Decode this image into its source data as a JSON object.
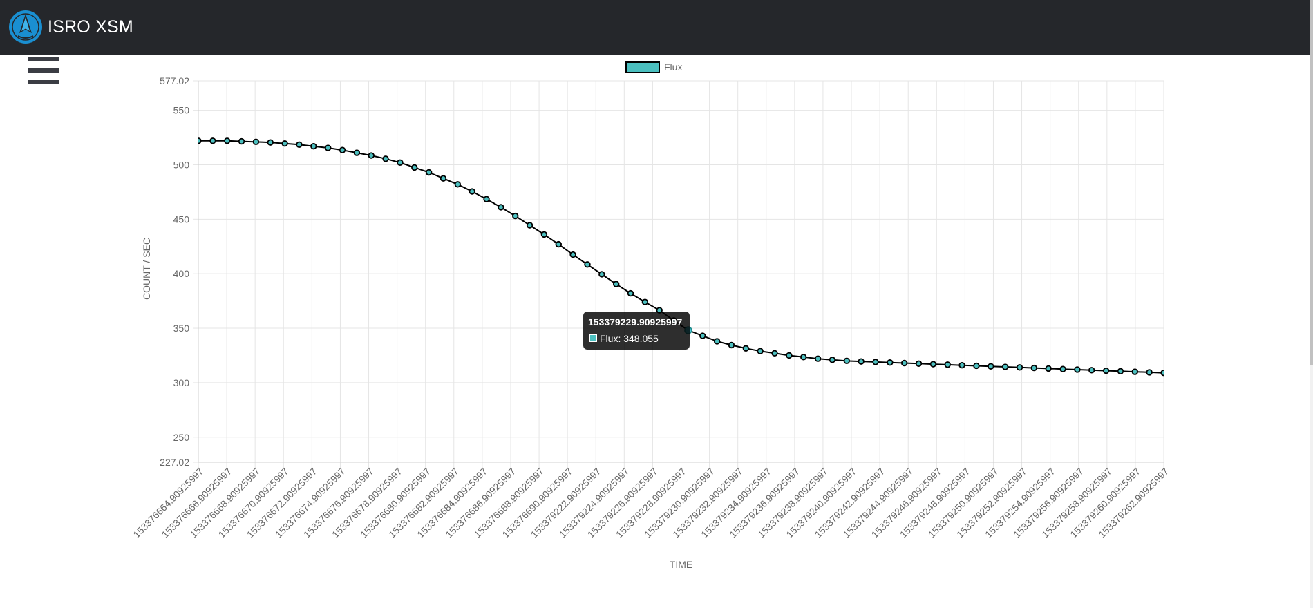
{
  "app": {
    "title": "ISRO XSM",
    "logo_icon": "isro-rocket-logo"
  },
  "menu": {
    "icon": "hamburger-menu-icon"
  },
  "colors": {
    "navbar": "#25272b",
    "series_fill": "#4bbfbf",
    "series_line": "#000000",
    "highlight": "#4bc8d8"
  },
  "chart_data": {
    "type": "line",
    "legend": [
      "Flux"
    ],
    "legend_position": "top",
    "xlabel": "TIME",
    "ylabel": "COUNT / SEC",
    "ylim": [
      227.02,
      577.02
    ],
    "yticks": [
      "577.02",
      "550",
      "500",
      "450",
      "400",
      "350",
      "300",
      "250",
      "227.02"
    ],
    "xticks": [
      "153376664.90925997",
      "153376666.90925997",
      "153376668.90925997",
      "153376670.90925997",
      "153376672.90925997",
      "153376674.90925997",
      "153376676.90925997",
      "153376678.90925997",
      "153376680.90925997",
      "153376682.90925997",
      "153376684.90925997",
      "153376686.90925997",
      "153376688.90925997",
      "153376690.90925997",
      "153379222.90925997",
      "153379224.90925997",
      "153379226.90925997",
      "153379228.90925997",
      "153379230.90925997",
      "153379232.90925997",
      "153379234.90925997",
      "153379236.90925997",
      "153379238.90925997",
      "153379240.90925997",
      "153379242.90925997",
      "153379244.90925997",
      "153379246.90925997",
      "153379248.90925997",
      "153379250.90925997",
      "153379252.90925997",
      "153379254.90925997",
      "153379256.90925997",
      "153379258.90925997",
      "153379260.90925997",
      "153379262.90925997"
    ],
    "grid": true,
    "series": [
      {
        "name": "Flux",
        "values": [
          522,
          522,
          522,
          521.5,
          521,
          520.5,
          519.5,
          518.5,
          517,
          515.5,
          513.5,
          511,
          508.5,
          505.5,
          502,
          497.5,
          493,
          487.5,
          482,
          475.5,
          468.5,
          461,
          453,
          444.5,
          436,
          427,
          417.5,
          408.5,
          399.5,
          390.5,
          382,
          374,
          366.5,
          357,
          348.055,
          343,
          338,
          334.5,
          331.5,
          329,
          327,
          325,
          323.5,
          322,
          321,
          320,
          319.5,
          319,
          318.5,
          318,
          317.5,
          317,
          316.5,
          316,
          315.5,
          315,
          314.5,
          314,
          313.5,
          313,
          312.5,
          312,
          311.5,
          311,
          310.5,
          310,
          309.5,
          309
        ]
      }
    ],
    "highlighted_point": {
      "index": 34,
      "time": "153379229.90925997",
      "value": 348.055
    }
  },
  "tooltip": {
    "title": "153379229.90925997",
    "body": "Flux: 348.055"
  }
}
